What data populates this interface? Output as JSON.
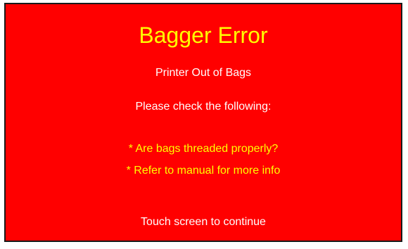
{
  "dialog": {
    "title": "Bagger Error",
    "message": "Printer Out of Bags",
    "instruction": "Please check the following:",
    "checklist": [
      "* Are bags threaded properly?",
      "* Refer to manual for more info"
    ],
    "continue_prompt": "Touch screen to continue"
  },
  "colors": {
    "background": "#ff0000",
    "title": "#ffff00",
    "body_text": "#ffffff",
    "checklist_text": "#ffff00",
    "border": "#1a1a1a"
  }
}
